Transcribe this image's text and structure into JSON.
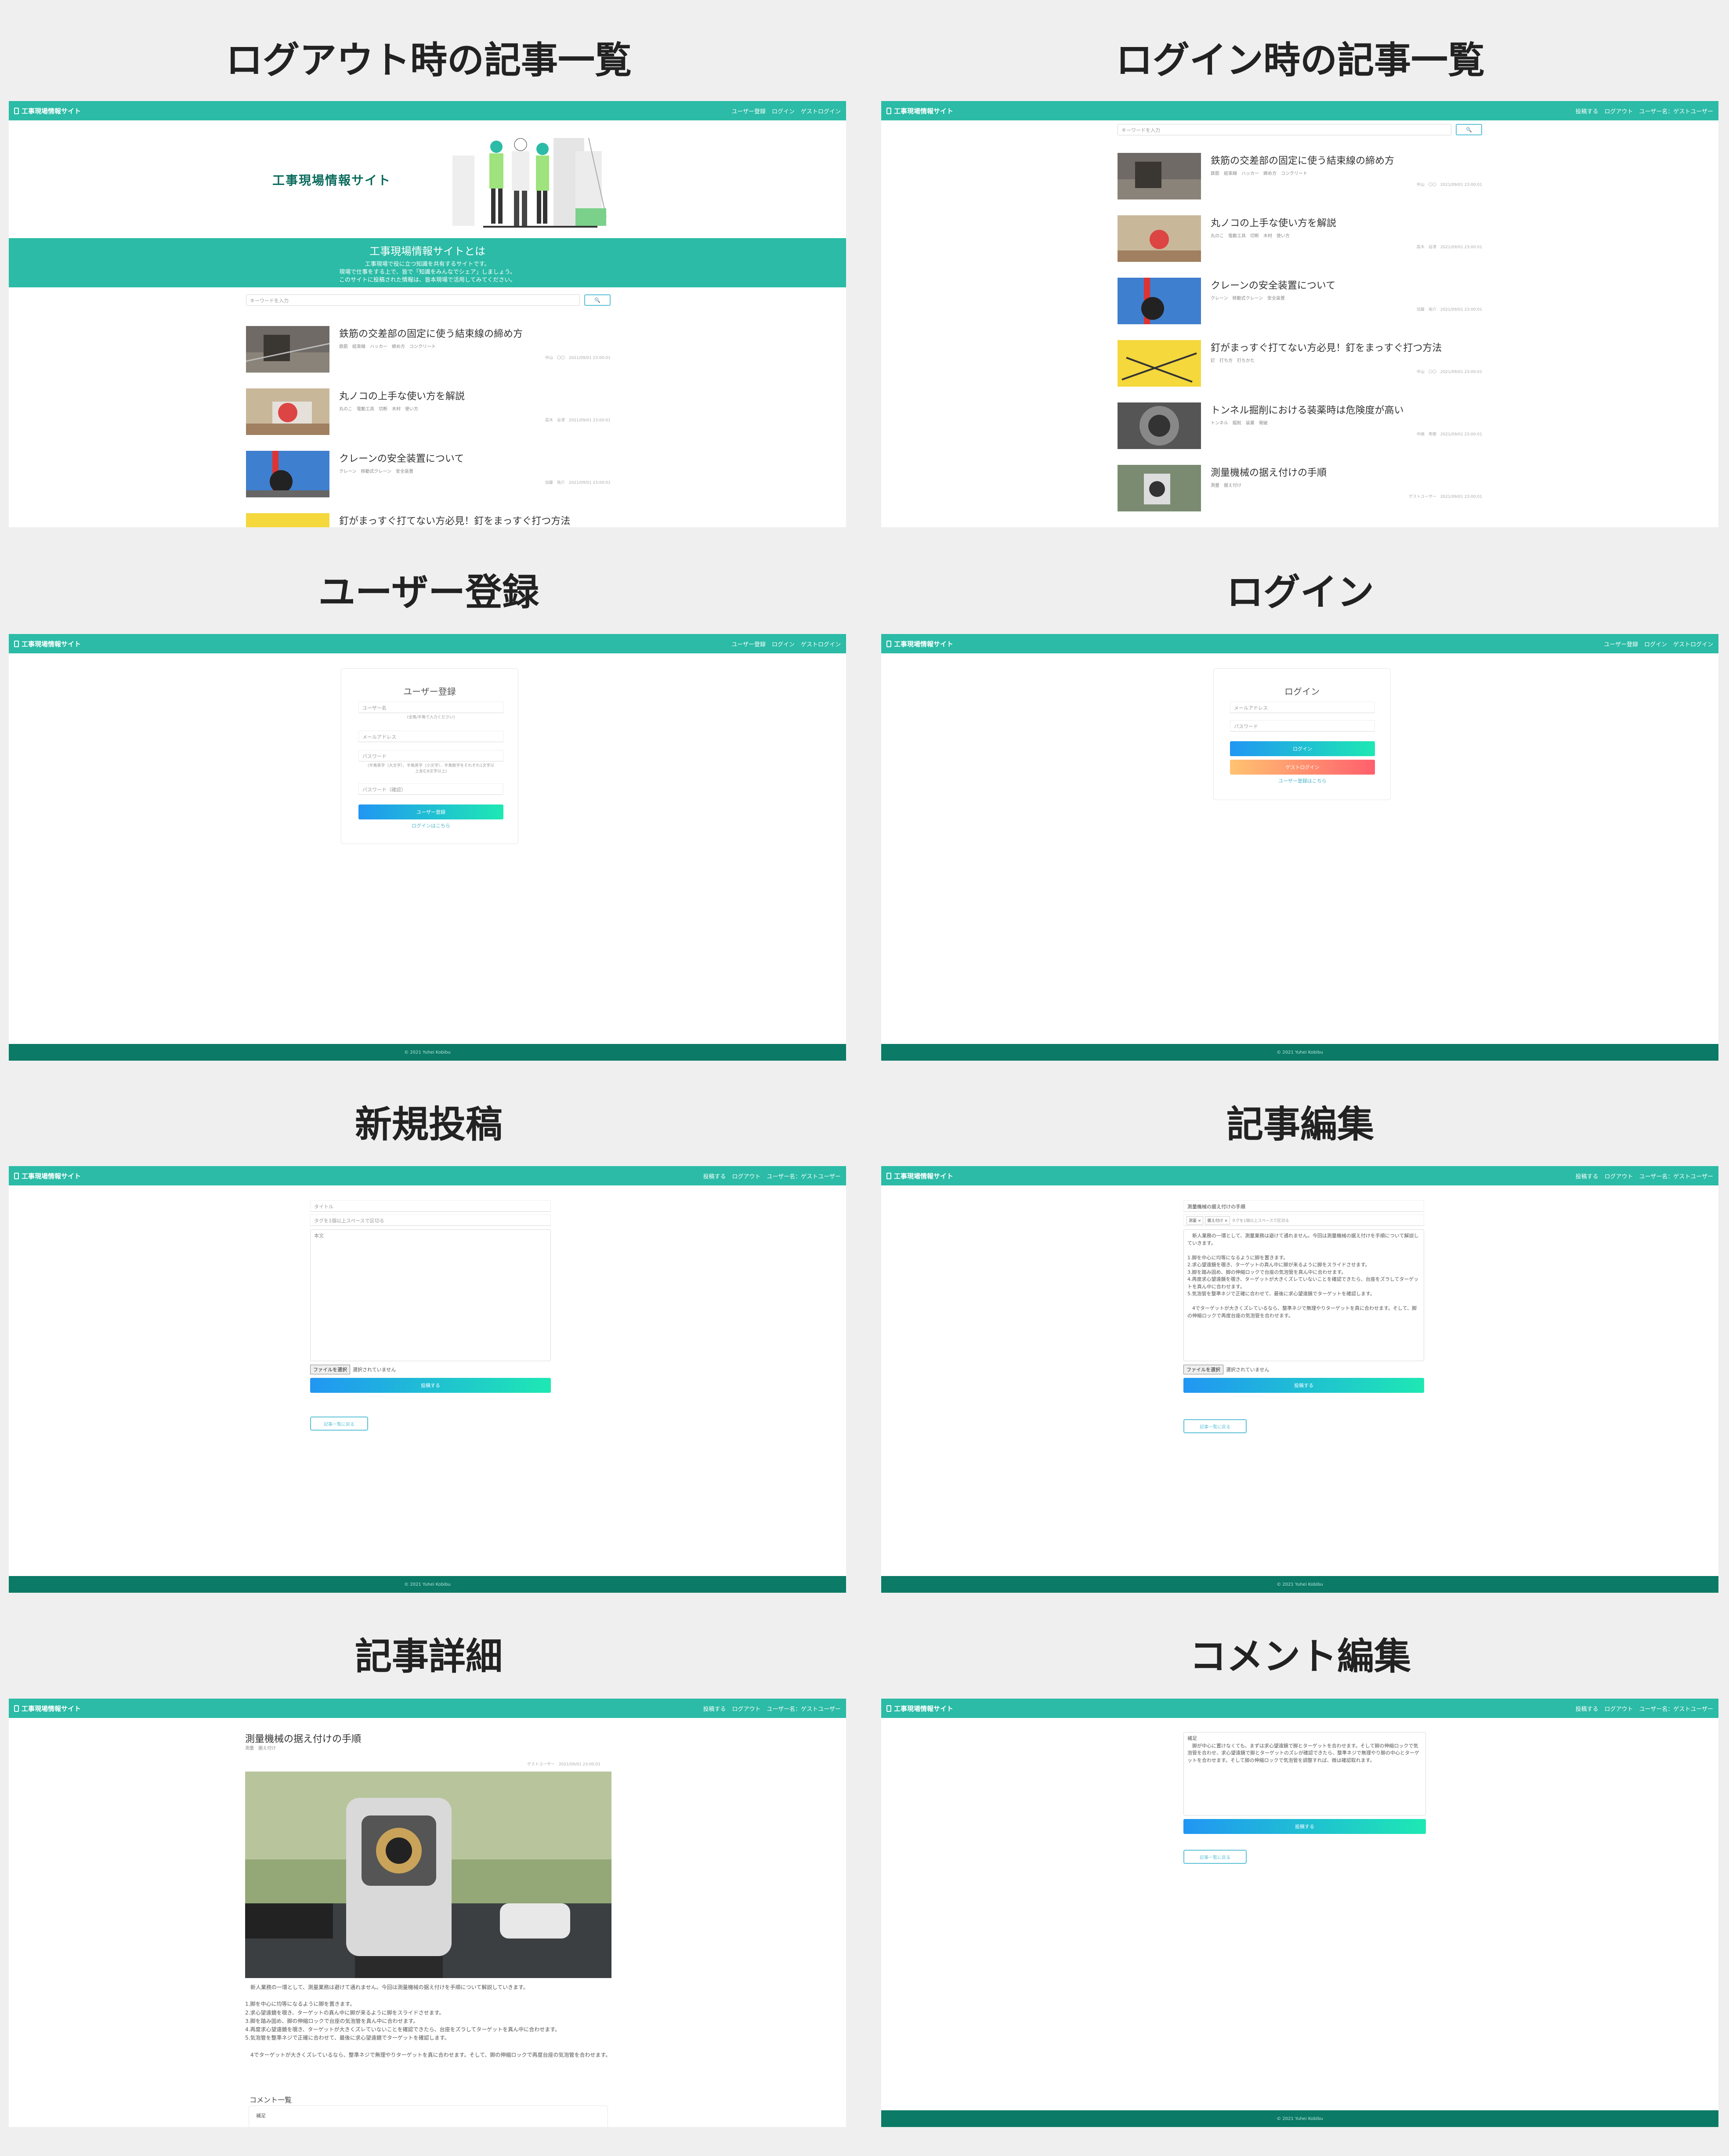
{
  "titles": {
    "logout_list": "ログアウト時の記事一覧",
    "login_list": "ログイン時の記事一覧",
    "register": "ユーザー登録",
    "login": "ログイン",
    "new_post": "新規投稿",
    "edit_post": "記事編集",
    "detail": "記事詳細",
    "comment_edit": "コメント編集"
  },
  "site": {
    "brand": "工事現場情報サイト",
    "hero_logo": "工事現場情報サイト",
    "footer": "© 2021 Yuhei Kobibu"
  },
  "nav": {
    "guest": [
      "ユーザー登録",
      "ログイン",
      "ゲストログイン"
    ],
    "user": [
      "投稿する",
      "ログアウト",
      "ユーザー名：ゲストユーザー"
    ]
  },
  "about": {
    "title": "工事現場情報サイトとは",
    "lines": [
      "工事現場で役に立つ知識を共有するサイトです。",
      "現場で仕事をする上で、皆で「知識をみんなでシェア」しましょう。",
      "このサイトに投稿された情報は、皆本現場で活用してみてください。"
    ]
  },
  "search": {
    "placeholder": "キーワードを入力",
    "button": "🔍"
  },
  "articles": [
    {
      "title": "鉄筋の交差部の固定に使う結束線の締め方",
      "tags": "鉄筋　結束線　ハッカー　締め方　コンクリート",
      "meta": "中山　〇〇　2021/09/01 23:00:01"
    },
    {
      "title": "丸ノコの上手な使い方を解説",
      "tags": "丸のこ　電動工具　切断　木材　使い方",
      "meta": "高木　谷津　2021/09/01 23:00:01"
    },
    {
      "title": "クレーンの安全装置について",
      "tags": "クレーン　移動式クレーン　安全装置",
      "meta": "加藤　祐介　2021/09/01 23:00:01"
    },
    {
      "title": "釘がまっすぐ打てない方必見！釘をまっすぐ打つ方法",
      "tags": "釘　打ち方　打ちかた",
      "meta": "中山　〇〇　2021/09/01 23:00:01"
    },
    {
      "title": "トンネル掘削における装薬時は危険度が高い",
      "tags": "トンネル　掘削　装薬　発破",
      "meta": "中嶋　秀樹　2021/09/01 23:00:01"
    },
    {
      "title": "測量機械の据え付けの手順",
      "tags": "測量　据え付け",
      "meta": "ゲストユーザー　2021/09/01 23:00:01"
    }
  ],
  "register": {
    "heading": "ユーザー登録",
    "name_ph": "ユーザー名",
    "name_hint": "(全角/半角で入力ください)",
    "email_ph": "メールアドレス",
    "pass_ph": "パスワード",
    "pass_hint": "(半角英字（大文字）、半角英字（小文字）、半角数字をそれぞれ1文字以上含む8文字以上)",
    "confirm_ph": "パスワード（確認）",
    "submit": "ユーザー登録",
    "link": "ログインはこちら"
  },
  "login": {
    "heading": "ログイン",
    "email_ph": "メールアドレス",
    "pass_ph": "パスワード",
    "submit": "ログイン",
    "guest": "ゲストログイン",
    "link": "ユーザー登録はこちら"
  },
  "post_form": {
    "title_ph": "タイトル",
    "tags_ph": "タグを1個以上スペースで区切る",
    "body_ph": "本文",
    "file_btn": "ファイルを選択",
    "file_none": "選択されていません",
    "submit": "投稿する",
    "back": "記事一覧に戻る"
  },
  "edit_form": {
    "title_val": "測量機械の据え付けの手順",
    "tag1": "測量 ×",
    "tag2": "据え付け ×",
    "tags_ph": "タグを1個以上スペースで区切る",
    "body": "　新人業務の一環として、測量業務は避けて通れません。今回は測量機械の据え付けを手順について解説していきます。\n\n1.脚を中心に均等になるように脚を置きます。\n2.求心望遠鏡を覗き、ターゲットの真ん中に脚が来るように脚をスライドさせます。\n3.脚を踏み固め、脚の伸縮ロックで台座の気泡管を真ん中に合わせます。\n4.再度求心望遠鏡を覗き、ターゲットが大きくズレていないことを確認できたら、台座をズラしてターゲットを真ん中に合わせます。\n5.気泡管を整準ネジで正確に合わせて、最後に求心望遠鏡でターゲットを確認します。\n\n　4でターゲットが大きくズレているなら、整準ネジで無理やりターゲットを真に合わせます。そして、脚の伸縮ロックで再度台座の気泡管を合わせます。",
    "submit": "投稿する",
    "back": "記事一覧に戻る"
  },
  "detail": {
    "title": "測量機械の据え付けの手順",
    "tags": "測量　据え付け",
    "meta": "ゲストユーザー　2021/09/01 23:00:01",
    "body": "　新人業務の一環として、測量業務は避けて通れません。今回は測量機械の据え付けを手順について解説していきます。\n\n1.脚を中心に均等になるように脚を置きます。\n2.求心望遠鏡を覗き、ターゲットの真ん中に脚が来るように脚をスライドさせます。\n3.脚を踏み固め、脚の伸縮ロックで台座の気泡管を真ん中に合わせます。\n4.再度求心望遠鏡を覗き、ターゲットが大きくズレていないことを確認できたら、台座をズラしてターゲットを真ん中に合わせます。\n5.気泡管を整準ネジで正確に合わせて、最後に求心望遠鏡でターゲットを確認します。\n\n　4でターゲットが大きくズレているなら、整準ネジで無理やりターゲットを真に合わせます。そして、脚の伸縮ロックで再度台座の気泡管を合わせます。",
    "comments_heading": "コメント一覧",
    "comment_label": "補足"
  },
  "comment_edit": {
    "body": "補足\n　脚が中心に置けなくても、まずは求心望遠鏡で脚とターゲットを合わせます。そして脚の伸縮ロックで気泡管を合わせ、求心望遠鏡で脚とターゲットのズレが確認できたら、整準ネジで無理やり脚の中心とターゲットを合わせます。そして脚の伸縮ロックで気泡管を調整すれば、微は確認取れます。",
    "submit": "投稿する",
    "back": "記事一覧に戻る"
  }
}
